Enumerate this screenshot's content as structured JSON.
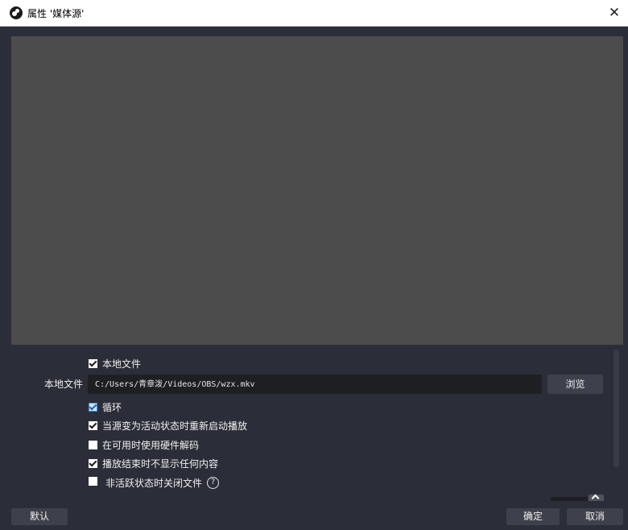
{
  "window": {
    "title": "属性 '媒体源'",
    "close_glyph": "✕"
  },
  "properties": {
    "local_file_checkbox": {
      "label": "本地文件",
      "checked": true
    },
    "local_file_field": {
      "label": "本地文件",
      "value": "C:/Users/青章泼/Videos/OBS/wzx.mkv",
      "browse_label": "浏览"
    },
    "checkboxes": [
      {
        "label": "循环",
        "checked": true
      },
      {
        "label": "当源变为活动状态时重新启动播放",
        "checked": true
      },
      {
        "label": "在可用时使用硬件解码",
        "checked": false
      },
      {
        "label": "播放结束时不显示任何内容",
        "checked": true
      },
      {
        "label": "非活跃状态时关闭文件",
        "checked": false
      }
    ],
    "help_glyph": "?"
  },
  "footer": {
    "defaults_label": "默认",
    "ok_label": "确定",
    "cancel_label": "取消"
  },
  "colors": {
    "background": "#2b2e38",
    "preview": "#4c4c4c",
    "input": "#1e1f23",
    "button": "#3e414b",
    "titlebar": "#ffffff",
    "accent_check": "#3c8dde"
  }
}
